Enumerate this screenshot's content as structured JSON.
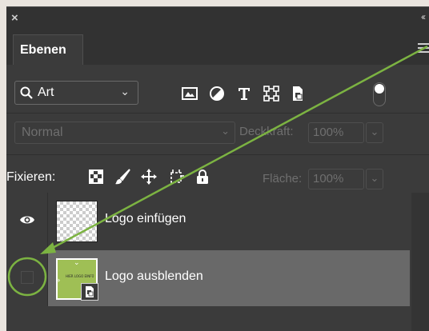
{
  "window": {
    "close_glyph": "×",
    "collapse_glyph": "‹‹"
  },
  "tabs": [
    {
      "label": "Ebenen"
    }
  ],
  "filter": {
    "kind_label": "Art",
    "icons": [
      "image-icon",
      "adjustment-icon",
      "type-icon",
      "shape-icon",
      "smart-object-icon"
    ]
  },
  "blend": {
    "mode": "Normal",
    "opacity_label": "Deckkraft:",
    "opacity_value": "100%"
  },
  "lock": {
    "label": "Fixieren:",
    "fill_label": "Fläche:",
    "fill_value": "100%",
    "icons": [
      "lock-transparent-icon",
      "lock-image-icon",
      "lock-position-icon",
      "lock-artboard-icon",
      "lock-all-icon"
    ]
  },
  "layers": [
    {
      "name": "Logo einfügen",
      "visible": true,
      "selected": false
    },
    {
      "name": "Logo ausblenden",
      "visible": false,
      "selected": true,
      "thumb_text": "HIER LOGO EINFÜ"
    }
  ],
  "annotation": {
    "color": "#7cb342"
  }
}
